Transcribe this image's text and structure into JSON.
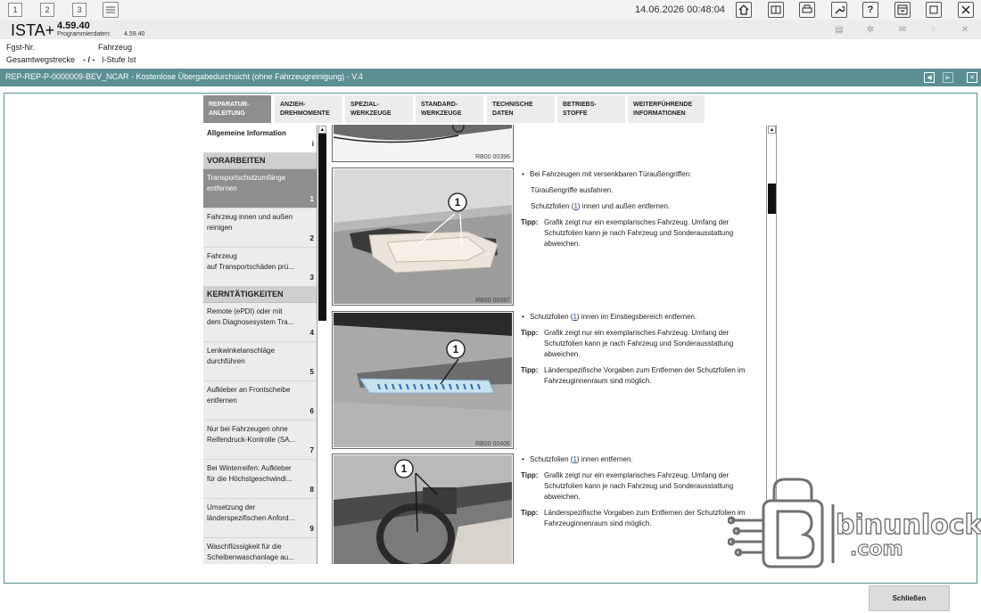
{
  "toolbar": {
    "window_buttons": [
      "1",
      "2",
      "3"
    ],
    "datetime": "14.06.2026 00:48:04",
    "icons": [
      "list-icon",
      "home-icon",
      "vehicle-data-icon",
      "printer-icon",
      "wrench-icon",
      "help-icon",
      "download-icon",
      "window-icon",
      "close-icon"
    ]
  },
  "app": {
    "name": "ISTA+",
    "version": "4.59.40",
    "program_label": "Programmierdaten:",
    "program_value": "4.59.40",
    "fgst_label": "Fgst-Nr.",
    "fahrzeug_label": "Fahrzeug",
    "gesamtweg_label": "Gesamtwegstrecke",
    "gesamtweg_value": "- / -",
    "istufe_label": "I-Stufe Ist"
  },
  "document": {
    "title": "REP-REP-P-0000009-BEV_NCAR - Kostenlose Übergabedurchsicht (ohne Fahrzeugreinigung) - V.4"
  },
  "tabs": [
    {
      "line1": "REPARATUR-",
      "line2": "ANLEITUNG",
      "active": true
    },
    {
      "line1": "ANZIEH-",
      "line2": "DREHMOMENTE",
      "active": false
    },
    {
      "line1": "SPEZIAL-",
      "line2": "WERKZEUGE",
      "active": false
    },
    {
      "line1": "STANDARD-",
      "line2": "WERKZEUGE",
      "active": false
    },
    {
      "line1": "TECHNISCHE",
      "line2": "DATEN",
      "active": false
    },
    {
      "line1": "BETRIEBS-",
      "line2": "STOFFE",
      "active": false
    },
    {
      "line1": "WEITERFÜHRENDE",
      "line2": "INFORMATIONEN",
      "active": false
    }
  ],
  "nav": {
    "info_label": "Allgemeine Information",
    "info_mark": "i",
    "section_vorarbeiten": "VORARBEITEN",
    "section_kern": "KERNTÄTIGKEITEN",
    "vorarbeiten_items": [
      {
        "line1": "Transportschutzumfänge",
        "line2": "entfernen",
        "num": "1"
      },
      {
        "line1": "Fahrzeug innen und außen",
        "line2": "reinigen",
        "num": "2"
      },
      {
        "line1": "Fahrzeug",
        "line2": "auf Transportschäden prü...",
        "num": "3"
      }
    ],
    "kern_items": [
      {
        "line1": "Remote (ePDI) oder mit",
        "line2": "dem Diagnosesystem Tra...",
        "num": "4"
      },
      {
        "line1": "Lenkwinkelanschläge",
        "line2": "durchführen",
        "num": "5"
      },
      {
        "line1": "Aufkleber an Frontscheibe",
        "line2": "entfernen",
        "num": "6"
      },
      {
        "line1": "Nur bei Fahrzeugen ohne",
        "line2": "Reifendruck-Kontrolle (SA...",
        "num": "7"
      },
      {
        "line1": "Bei Winterreifen: Aufkleber",
        "line2": "für die Höchstgeschwindi...",
        "num": "8"
      },
      {
        "line1": "Umsetzung der",
        "line2": "länderspezifischen Anford...",
        "num": "9"
      },
      {
        "line1": "Waschflüssigkeit für die",
        "line2": "Scheibenwaschanlage au...",
        "num": ""
      }
    ]
  },
  "content": {
    "figures": [
      {
        "code": "RB00 00396",
        "callout": ""
      },
      {
        "code": "RB00 00397",
        "callout": "1"
      },
      {
        "code": "RB00 00406",
        "callout": "1"
      },
      {
        "code": "",
        "callout": "1"
      }
    ],
    "block1": {
      "bullet": "Bei Fahrzeugen mit versenkbaren Türaußengriffen:",
      "line2": "Türaußengriffe ausfahren.",
      "line3_pre": "Schutzfolien (",
      "line3_link": "1",
      "line3_post": ") innen und außen entfernen.",
      "tip_label": "Tipp:",
      "tip_text": "Grafik zeigt nur ein exemplarisches Fahrzeug. Umfang der Schutzfolien kann je nach Fahrzeug und Sonderausstattung abweichen."
    },
    "block2": {
      "bullet_pre": "Schutzfolien (",
      "bullet_link": "1",
      "bullet_post": ") innen im Einstiegsbereich entfernen.",
      "tip1_label": "Tipp:",
      "tip1_text": "Grafik zeigt nur ein exemplarisches Fahrzeug. Umfang der Schutzfolien kann je nach Fahrzeug und Sonderausstattung abweichen.",
      "tip2_label": "Tipp:",
      "tip2_text": "Länderspezifische Vorgaben zum Entfernen der Schutzfolien im Fahrzeuginnenraum sind möglich."
    },
    "block3": {
      "bullet_pre": "Schutzfolien (",
      "bullet_link": "1",
      "bullet_post": ") innen entfernen.",
      "tip1_label": "Tipp:",
      "tip1_text": "Grafik zeigt nur ein exemplarisches Fahrzeug. Umfang der Schutzfolien kann je nach Fahrzeug und Sonderausstattung abweichen.",
      "tip2_label": "Tipp:",
      "tip2_text": "Länderspezifische Vorgaben zum Entfernen der Schutzfolien im Fahrzeuginnenraum sind möglich."
    }
  },
  "watermark": {
    "line1": "binunlock",
    "line2": ".com"
  },
  "footer": {
    "close_label": "Schließen"
  }
}
